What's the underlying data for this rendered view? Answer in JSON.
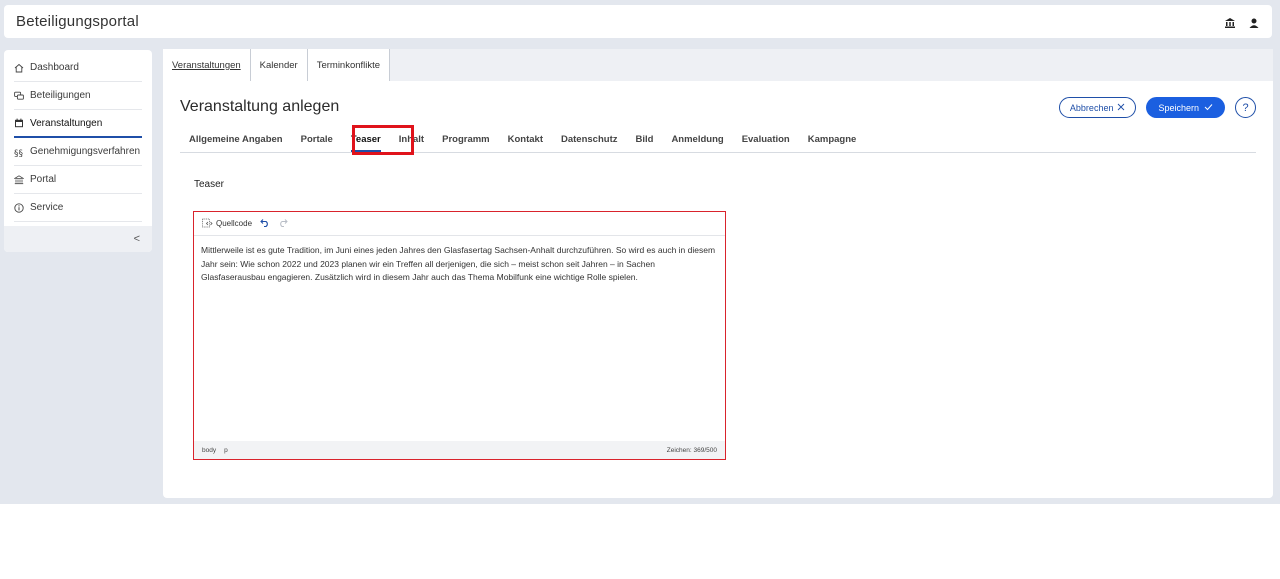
{
  "header": {
    "title": "Beteiligungsportal",
    "icons": [
      "bank-icon",
      "user-icon"
    ]
  },
  "sidebar": {
    "items": [
      {
        "label": "Dashboard",
        "icon": "home-icon",
        "active": false
      },
      {
        "label": "Beteiligungen",
        "icon": "chat-icon",
        "active": false
      },
      {
        "label": "Veranstaltungen",
        "icon": "calendar-icon",
        "active": true
      },
      {
        "label": "Genehmigungsverfahren",
        "icon": "section-icon",
        "active": false
      },
      {
        "label": "Portal",
        "icon": "bank-icon",
        "active": false
      },
      {
        "label": "Service",
        "icon": "info-icon",
        "active": false
      }
    ],
    "collapse_label": "<"
  },
  "top_tabs": [
    {
      "label": "Veranstaltungen",
      "active": true
    },
    {
      "label": "Kalender",
      "active": false
    },
    {
      "label": "Terminkonflikte",
      "active": false
    }
  ],
  "page": {
    "title": "Veranstaltung anlegen",
    "cancel_label": "Abbrechen",
    "save_label": "Speichern",
    "help_label": "?"
  },
  "sub_tabs": [
    {
      "label": "Allgemeine Angaben"
    },
    {
      "label": "Portale"
    },
    {
      "label": "Teaser",
      "active": true
    },
    {
      "label": "Inhalt"
    },
    {
      "label": "Programm"
    },
    {
      "label": "Kontakt"
    },
    {
      "label": "Datenschutz"
    },
    {
      "label": "Bild"
    },
    {
      "label": "Anmeldung"
    },
    {
      "label": "Evaluation"
    },
    {
      "label": "Kampagne"
    }
  ],
  "section": {
    "label": "Teaser"
  },
  "editor": {
    "source_label": "Quellcode",
    "content": "Mittlerweile ist es gute Tradition, im Juni eines jeden Jahres den Glasfasertag Sachsen-Anhalt durchzuführen. So wird es auch in diesem Jahr sein: Wie schon 2022 und 2023 planen wir ein Treffen all derjenigen, die sich – meist schon seit Jahren – in Sachen Glasfaserausbau engagieren. Zusätzlich wird in diesem Jahr auch das Thema Mobilfunk eine wichtige Rolle spielen.",
    "path": [
      "body",
      "p"
    ],
    "char_count": "Zeichen: 369/500"
  },
  "colors": {
    "accent": "#1f4fa8",
    "primary_button": "#1b5fe0",
    "highlight": "#e0131b",
    "editor_border": "#d9232c"
  }
}
